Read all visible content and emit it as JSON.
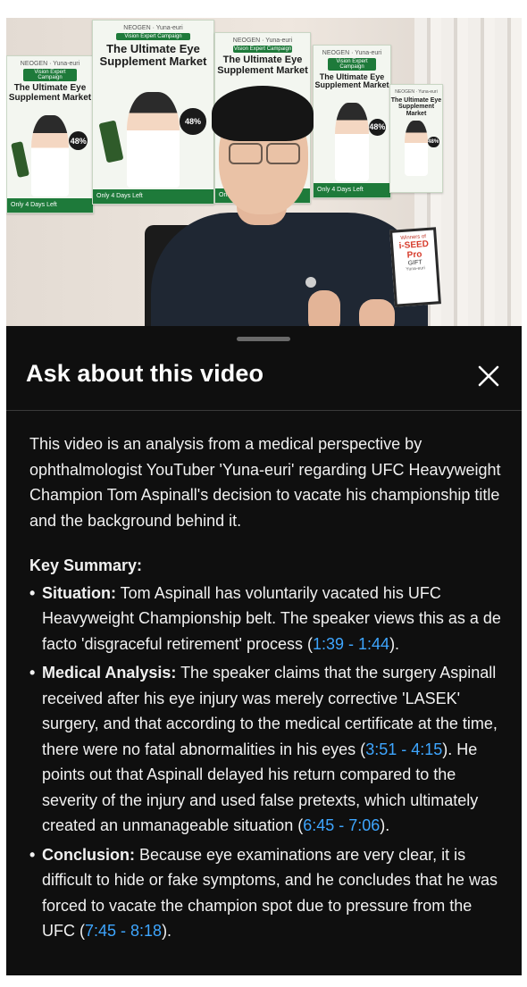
{
  "video": {
    "poster": {
      "brand": "NEOGEN · Yuna-euri",
      "tag": "Vision Expert Campaign",
      "headline": "The Ultimate Eye Supplement Market",
      "discount": "48%",
      "footer": "Only 4 Days Left"
    },
    "sign": {
      "line1": "Winners of",
      "line2": "i-SEED Pro",
      "line3": "GIFT",
      "line4": "Yuna-euri"
    }
  },
  "panel": {
    "title": "Ask about this video",
    "intro": "This video is an analysis from a medical perspective by ophthalmologist YouTuber 'Yuna-euri' regarding UFC Heavyweight Champion Tom Aspinall's decision to vacate his championship title and the background behind it.",
    "summary_heading": "Key Summary:",
    "points": [
      {
        "label": "Situation:",
        "text": " Tom Aspinall has voluntarily vacated his UFC Heavyweight Championship belt. The speaker views this as a de facto 'disgraceful retirement' process (",
        "ts1": "1:39 - 1:44",
        "end": ")."
      },
      {
        "label": "Medical Analysis:",
        "text": " The speaker claims that the surgery Aspinall received after his eye injury was merely corrective 'LASEK' surgery, and that according to the medical certificate at the time, there were no fatal abnormalities in his eyes (",
        "ts1": "3:51 - 4:15",
        "mid": "). He points out that Aspinall delayed his return compared to the severity of the injury and used false pretexts, which ultimately created an unmanageable situation (",
        "ts2": "6:45 - 7:06",
        "end": ")."
      },
      {
        "label": "Conclusion:",
        "text": " Because eye examinations are very clear, it is difficult to hide or fake symptoms, and he concludes that he was forced to vacate the champion spot due to pressure from the UFC (",
        "ts1": "7:45 - 8:18",
        "end": ")."
      }
    ]
  },
  "icons": {
    "close": "close-icon",
    "drag": "drag-handle"
  },
  "colors": {
    "panel_bg": "#0f0f0f",
    "text": "#f1f1f1",
    "timestamp_link": "#3ea6ff"
  }
}
